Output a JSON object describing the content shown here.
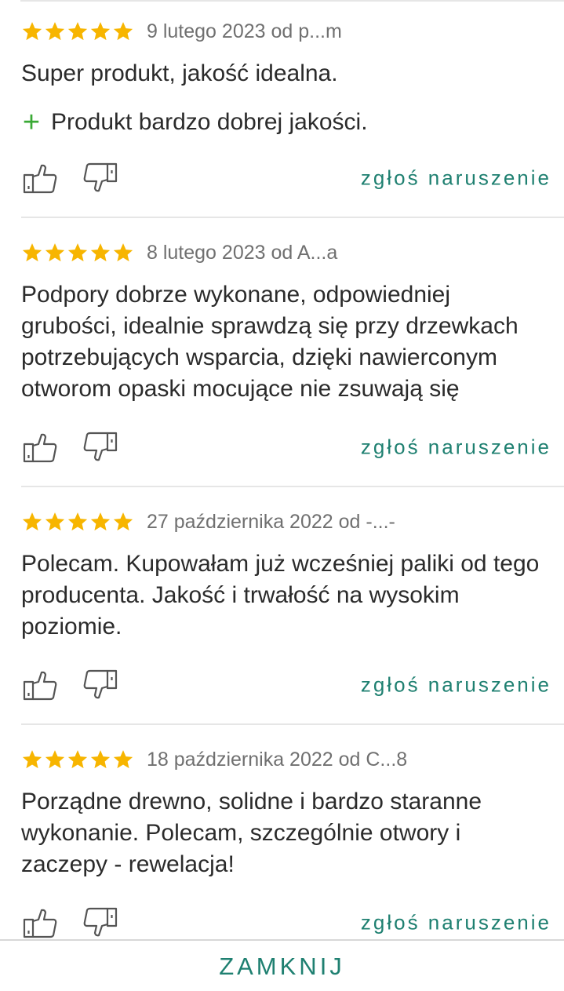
{
  "reviews": [
    {
      "rating": 5,
      "meta": "9 lutego 2023 od p...m",
      "text": "Super produkt, jakość idealna.",
      "pros": [
        "Produkt bardzo dobrej jakości."
      ],
      "report_label": "zgłoś naruszenie"
    },
    {
      "rating": 5,
      "meta": "8 lutego 2023 od A...a",
      "text": "Podpory dobrze wykonane, odpowiedniej grubości, idealnie sprawdzą się przy drzewkach potrzebujących wsparcia, dzięki nawierconym otworom opaski mocujące nie zsuwają się",
      "pros": [],
      "report_label": "zgłoś naruszenie"
    },
    {
      "rating": 5,
      "meta": "27 października 2022 od -...-",
      "text": "Polecam. Kupowałam już wcześniej paliki od tego producenta. Jakość i trwałość na wysokim poziomie.",
      "pros": [],
      "report_label": "zgłoś naruszenie"
    },
    {
      "rating": 5,
      "meta": "18 października 2022 od C...8",
      "text": "Porządne drewno, solidne i bardzo staranne wykonanie. Polecam, szczególnie otwory i zaczepy - rewelacja!",
      "pros": [],
      "report_label": "zgłoś naruszenie"
    }
  ],
  "footer": {
    "close_label": "ZAMKNIJ"
  },
  "colors": {
    "star": "#f7b500",
    "accent": "#1f8071",
    "pro_plus": "#3aa935",
    "divider": "#e6e6e6"
  },
  "icons": {
    "star": "star-icon",
    "thumbs_up": "thumbs-up-icon",
    "thumbs_down": "thumbs-down-icon",
    "plus": "plus-icon"
  }
}
